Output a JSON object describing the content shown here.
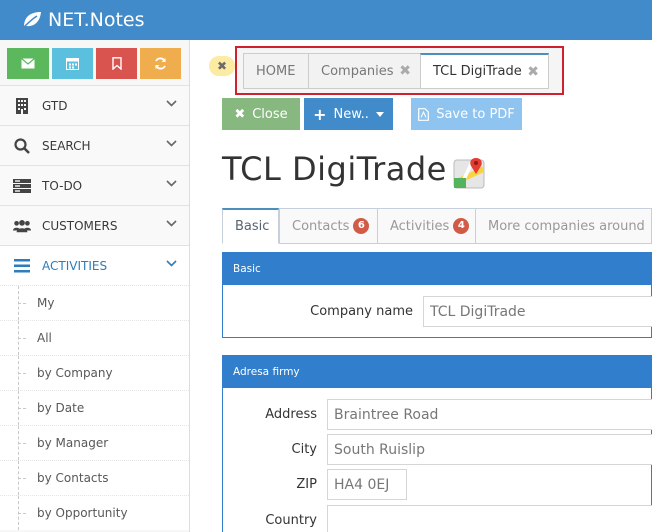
{
  "app": {
    "title": "NET.Notes"
  },
  "sidebar": {
    "items": [
      {
        "label": "GTD",
        "icon": "building-icon"
      },
      {
        "label": "SEARCH",
        "icon": "search-icon"
      },
      {
        "label": "TO-DO",
        "icon": "server-icon"
      },
      {
        "label": "CUSTOMERS",
        "icon": "users-icon"
      },
      {
        "label": "ACTIVITIES",
        "icon": "list-icon"
      }
    ],
    "subitems": [
      "My",
      "All",
      "by Company",
      "by Date",
      "by Manager",
      "by Contacts",
      "by Opportunity"
    ]
  },
  "tabs": [
    {
      "label": "HOME"
    },
    {
      "label": "Companies",
      "close": "✖"
    },
    {
      "label": "TCL DigiTrade",
      "close": "✖"
    }
  ],
  "toolbar": {
    "close_label": "Close",
    "new_label": "New..",
    "pdf_label": "Save to PDF"
  },
  "page": {
    "title": "TCL DigiTrade"
  },
  "content_tabs": [
    {
      "label": "Basic"
    },
    {
      "label": "Contacts",
      "badge": "6"
    },
    {
      "label": "Activities",
      "badge": "4"
    },
    {
      "label": "More companies around"
    }
  ],
  "basic_panel": {
    "title": "Basic",
    "company_name_label": "Company name",
    "company_name_value": "TCL DigiTrade"
  },
  "address_panel": {
    "title": "Adresa firmy",
    "address_label": "Address",
    "address_value": "Braintree Road",
    "city_label": "City",
    "city_value": "South Ruislip",
    "zip_label": "ZIP",
    "zip_value": "HA4 0EJ",
    "country_label": "Country",
    "country_value": ""
  },
  "colors": {
    "header": "#428bca",
    "close_btn": "#87b87f",
    "new_btn": "#428bca",
    "pdf_btn": "#8ec4ef",
    "highlight": "#d0222e"
  }
}
